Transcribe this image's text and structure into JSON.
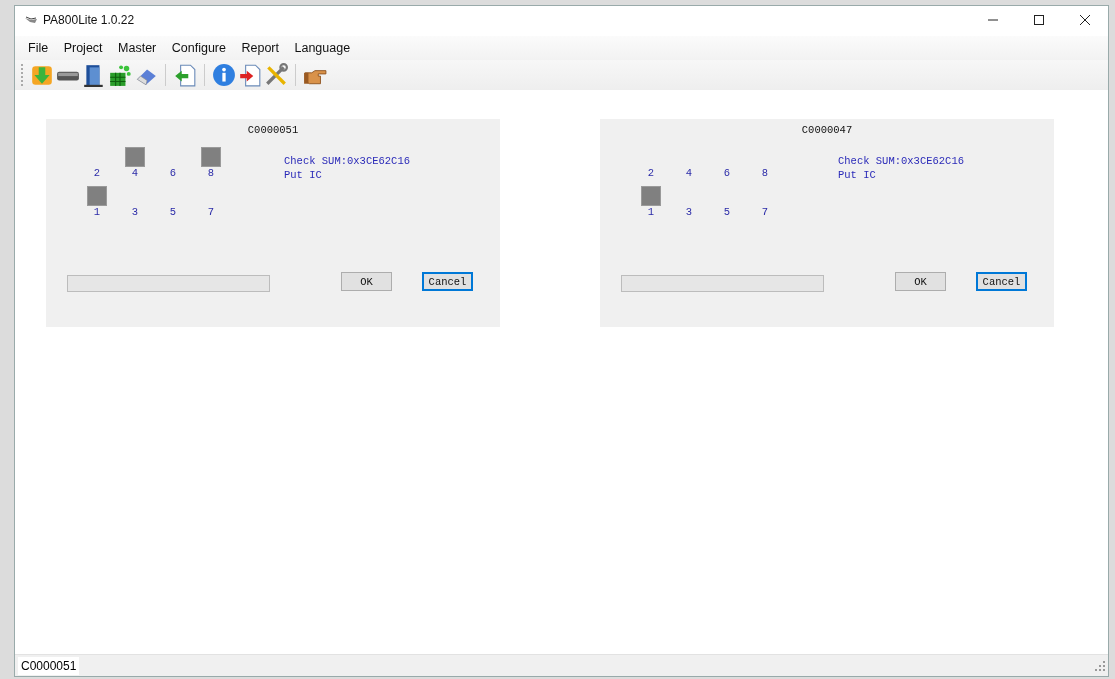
{
  "window": {
    "title": "PA800Lite 1.0.22"
  },
  "menu": [
    "File",
    "Project",
    "Master",
    "Configure",
    "Report",
    "Language"
  ],
  "panels": [
    {
      "title": "C0000051",
      "pin_rows": [
        [
          {
            "label": "2",
            "occupied": false
          },
          {
            "label": "4",
            "occupied": true
          },
          {
            "label": "6",
            "occupied": false
          },
          {
            "label": "8",
            "occupied": true
          }
        ],
        [
          {
            "label": "1",
            "occupied": true
          },
          {
            "label": "3",
            "occupied": false
          },
          {
            "label": "5",
            "occupied": false
          },
          {
            "label": "7",
            "occupied": false
          }
        ]
      ],
      "info": [
        "Check SUM:0x3CE62C16",
        "Put IC"
      ],
      "progress": {
        "level": 0
      },
      "buttons": [
        {
          "label": "OK",
          "default": false
        },
        {
          "label": "Cancel",
          "default": true
        }
      ]
    },
    {
      "title": "C0000047",
      "pin_rows": [
        [
          {
            "label": "2",
            "occupied": false
          },
          {
            "label": "4",
            "occupied": false
          },
          {
            "label": "6",
            "occupied": false
          },
          {
            "label": "8",
            "occupied": false
          }
        ],
        [
          {
            "label": "1",
            "occupied": true
          },
          {
            "label": "3",
            "occupied": false
          },
          {
            "label": "5",
            "occupied": false
          },
          {
            "label": "7",
            "occupied": false
          }
        ]
      ],
      "info": [
        "Check SUM:0x3CE62C16",
        "Put IC"
      ],
      "progress": {
        "level": 0
      },
      "buttons": [
        {
          "label": "OK",
          "default": false
        },
        {
          "label": "Cancel",
          "default": true
        }
      ]
    }
  ],
  "status_bar": "C0000051"
}
